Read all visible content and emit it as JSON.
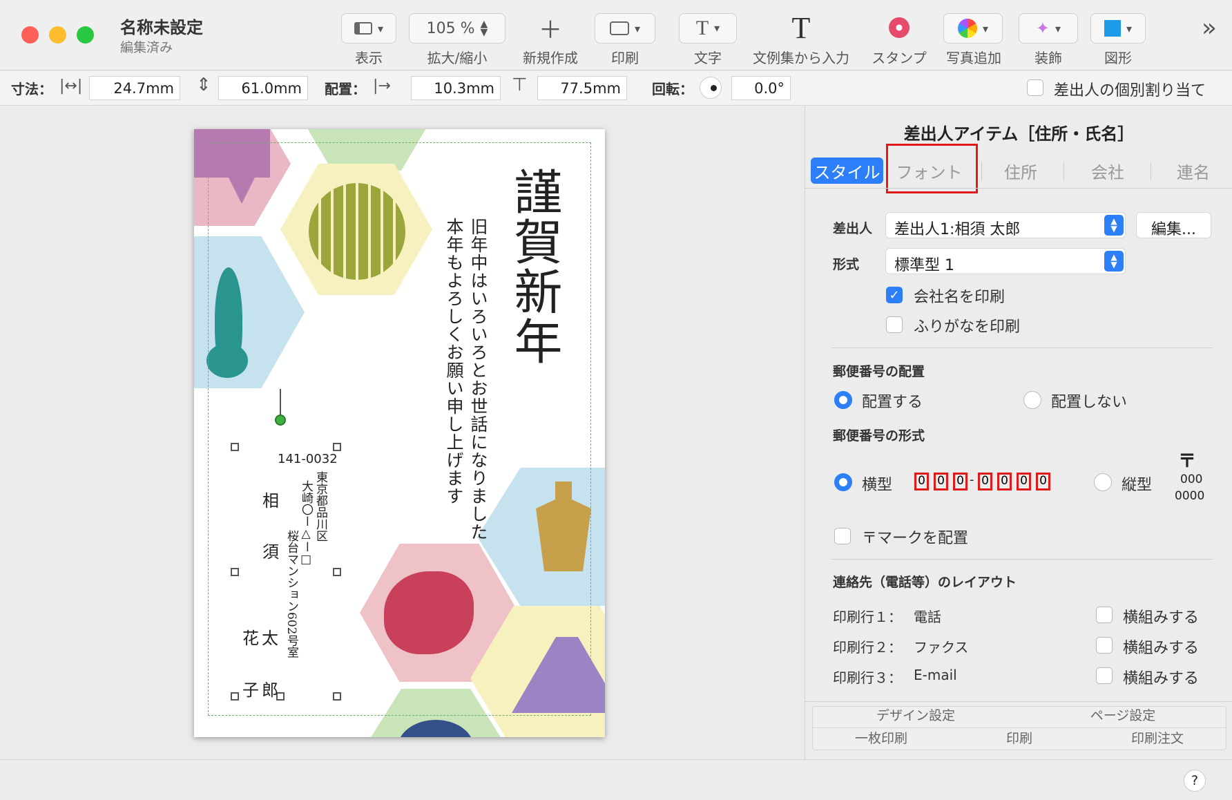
{
  "window": {
    "title": "名称未設定",
    "subtitle": "編集済み"
  },
  "toolbar": {
    "zoom_value": "105 %",
    "items": [
      {
        "label": "表示",
        "icon": "sidebar-icon"
      },
      {
        "label": "拡大/縮小",
        "icon": "zoom-stepper"
      },
      {
        "label": "新規作成",
        "icon": "plus-icon"
      },
      {
        "label": "印刷",
        "icon": "printer-icon"
      },
      {
        "label": "文字",
        "icon": "text-icon"
      },
      {
        "label": "文例集から入力",
        "icon": "text-large-icon"
      },
      {
        "label": "スタンプ",
        "icon": "stamp-icon"
      },
      {
        "label": "写真追加",
        "icon": "photos-icon"
      },
      {
        "label": "装飾",
        "icon": "wand-icon"
      },
      {
        "label": "図形",
        "icon": "shape-icon"
      }
    ],
    "more_icon": "double-chevron-right-icon"
  },
  "propbar": {
    "size_label": "寸法：",
    "width": "24.7mm",
    "height": "61.0mm",
    "position_label": "配置：",
    "x": "10.3mm",
    "y": "77.5mm",
    "rotation_label": "回転：",
    "rotation": "0.0°",
    "per_sender_label": "差出人の個別割り当て"
  },
  "card": {
    "greeting": "謹賀新年",
    "message_line1": "旧年中はいろいろとお世話になりました",
    "message_line2": "本年もよろしくお願い申し上げます",
    "postal_code": "141-0032",
    "address_line1": "東京都品川区",
    "address_line2": "大崎〇ー△ー□",
    "address_line3": "桜台マンション602号室",
    "surname_1": "相",
    "surname_2": "須",
    "given_1a": "花",
    "given_1b": "子",
    "given_2a": "太",
    "given_2b": "郎"
  },
  "panel": {
    "title": "差出人アイテム［住所・氏名］",
    "tabs": [
      "スタイル",
      "フォント",
      "住所",
      "会社",
      "連名"
    ],
    "active_tab": "スタイル",
    "sender_label": "差出人",
    "sender_value": "差出人1:相須 太郎",
    "edit_button": "編集...",
    "format_label": "形式",
    "format_value": "標準型 1",
    "print_company": "会社名を印刷",
    "print_furigana": "ふりがなを印刷",
    "postal_position_heading": "郵便番号の配置",
    "place": "配置する",
    "no_place": "配置しない",
    "postal_format_heading": "郵便番号の形式",
    "horizontal": "横型",
    "vertical": "縦型",
    "zip_digits": [
      "0",
      "0",
      "0",
      "-",
      "0",
      "0",
      "0",
      "0"
    ],
    "vertical_zip_top": "〒",
    "vertical_zip_mid": "000",
    "vertical_zip_bottom": "0000",
    "postal_mark": "〒マークを配置",
    "contact_heading": "連絡先（電話等）のレイアウト",
    "print_rows": [
      {
        "label": "印刷行１：",
        "value": "電話",
        "option": "横組みする"
      },
      {
        "label": "印刷行２：",
        "value": "ファクス",
        "option": "横組みする"
      },
      {
        "label": "印刷行３：",
        "value": "E-mail",
        "option": "横組みする"
      }
    ],
    "bottom_buttons": [
      "デザイン設定",
      "ページ設定",
      "一枚印刷",
      "印刷",
      "印刷注文"
    ]
  },
  "help_label": "?",
  "colors": {
    "accent": "#2d7ff9",
    "highlight": "#e0191a"
  }
}
